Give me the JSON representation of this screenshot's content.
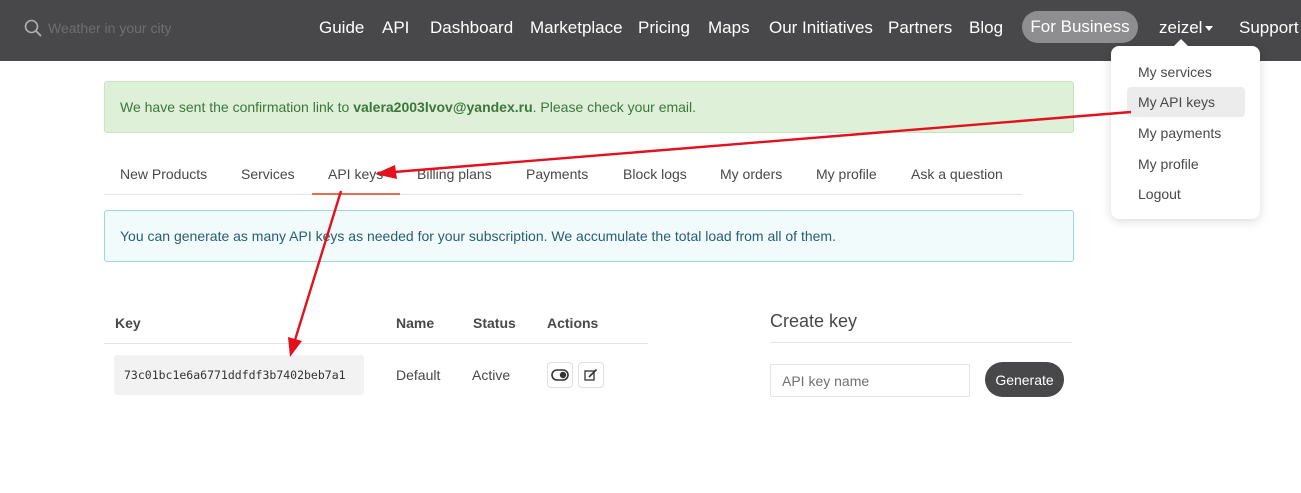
{
  "header": {
    "search_placeholder": "Weather in your city",
    "nav": [
      "Guide",
      "API",
      "Dashboard",
      "Marketplace",
      "Pricing",
      "Maps",
      "Our Initiatives",
      "Partners",
      "Blog"
    ],
    "for_business": "For Business",
    "user": "zeizel",
    "support": "Support"
  },
  "user_menu": {
    "items": [
      "My services",
      "My API keys",
      "My payments",
      "My profile",
      "Logout"
    ],
    "active_item": "My API keys"
  },
  "alert_success": {
    "prefix": "We have sent the confirmation link to ",
    "email": "valera2003lvov@yandex.ru",
    "suffix": ". Please check your email."
  },
  "tabs": {
    "items": [
      "New Products",
      "Services",
      "API keys",
      "Billing plans",
      "Payments",
      "Block logs",
      "My orders",
      "My profile",
      "Ask a question"
    ],
    "active": "API keys"
  },
  "alert_info": {
    "text": "You can generate as many API keys as needed for your subscription. We accumulate the total load from all of them."
  },
  "keys_table": {
    "headers": {
      "key": "Key",
      "name": "Name",
      "status": "Status",
      "actions": "Actions"
    },
    "rows": [
      {
        "key": "73c01bc1e6a6771ddfdf3b7402beb7a1",
        "name": "Default",
        "status": "Active"
      }
    ]
  },
  "create_key": {
    "title": "Create key",
    "placeholder": "API key name",
    "button": "Generate"
  },
  "colors": {
    "topbar": "#48484a",
    "accent": "#e96e50",
    "annotation_arrow": "#e3101e",
    "success_bg": "#dff0d8",
    "info_border": "#9fd8d6"
  },
  "icons": [
    "search-icon",
    "toggle-icon",
    "edit-icon",
    "caret-down-icon"
  ]
}
